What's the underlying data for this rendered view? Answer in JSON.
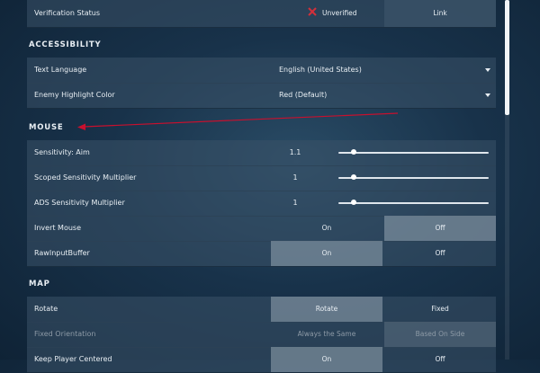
{
  "sections": {
    "accessibility": "ACCESSIBILITY",
    "mouse": "MOUSE",
    "map": "MAP"
  },
  "verification": {
    "label": "Verification Status",
    "status": "Unverified",
    "link_label": "Link"
  },
  "accessibility": {
    "text_language": {
      "label": "Text Language",
      "value": "English (United States)"
    },
    "enemy_highlight": {
      "label": "Enemy Highlight Color",
      "value": "Red (Default)"
    }
  },
  "mouse": {
    "sensitivity_aim": {
      "label": "Sensitivity: Aim",
      "value": "1.1",
      "level": 0.1
    },
    "scoped_multiplier": {
      "label": "Scoped Sensitivity Multiplier",
      "value": "1",
      "level": 0.1
    },
    "ads_multiplier": {
      "label": "ADS Sensitivity Multiplier",
      "value": "1",
      "level": 0.1
    },
    "invert_mouse": {
      "label": "Invert Mouse",
      "on": "On",
      "off": "Off",
      "selected": "Off"
    },
    "raw_input_buffer": {
      "label": "RawInputBuffer",
      "on": "On",
      "off": "Off",
      "selected": "On"
    }
  },
  "map": {
    "rotate": {
      "label": "Rotate",
      "opt_a": "Rotate",
      "opt_b": "Fixed",
      "selected": "Rotate"
    },
    "fixed_orientation": {
      "label": "Fixed Orientation",
      "opt_a": "Always the Same",
      "opt_b": "Based On Side",
      "selected": "Based On Side"
    },
    "keep_player_centered": {
      "label": "Keep Player Centered",
      "opt_a": "On",
      "opt_b": "Off"
    }
  },
  "colors": {
    "accent_red": "#d32f3a",
    "annotation_arrow": "#c8102e"
  }
}
